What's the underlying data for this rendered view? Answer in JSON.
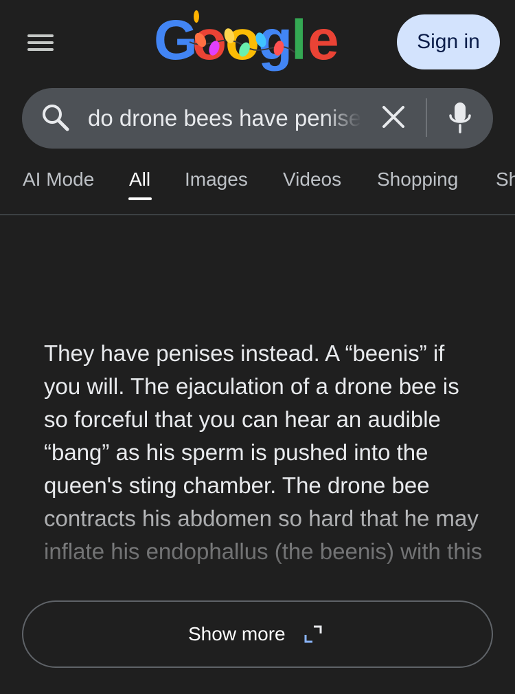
{
  "header": {
    "logo_text": "Google",
    "sign_in_label": "Sign in"
  },
  "search": {
    "query": "do drone bees have penises"
  },
  "tabs": [
    {
      "label": "AI Mode"
    },
    {
      "label": "All"
    },
    {
      "label": "Images"
    },
    {
      "label": "Videos"
    },
    {
      "label": "Shopping"
    },
    {
      "label": "Sh"
    }
  ],
  "active_tab": "All",
  "answer": {
    "text": "They have penises instead. A “beenis” if you will. The ejaculation of a drone bee is so forceful that you can hear an audible “bang” as his sperm is pushed into the queen's sting chamber. The drone bee contracts his abdomen so hard that he may inflate his endophallus (the beenis) with this"
  },
  "show_more": {
    "label": "Show more"
  },
  "icons": {
    "menu": "hamburger-menu-icon",
    "search": "search-icon",
    "clear": "close-icon",
    "mic": "microphone-icon",
    "expand": "expand-icon"
  },
  "colors": {
    "background": "#1f1f1f",
    "searchbar": "#4d5156",
    "sign_in_bg": "#d3e3fd",
    "google_blue": "#4285f4",
    "google_red": "#ea4335",
    "google_yellow": "#fbbc05",
    "google_green": "#34a853"
  }
}
